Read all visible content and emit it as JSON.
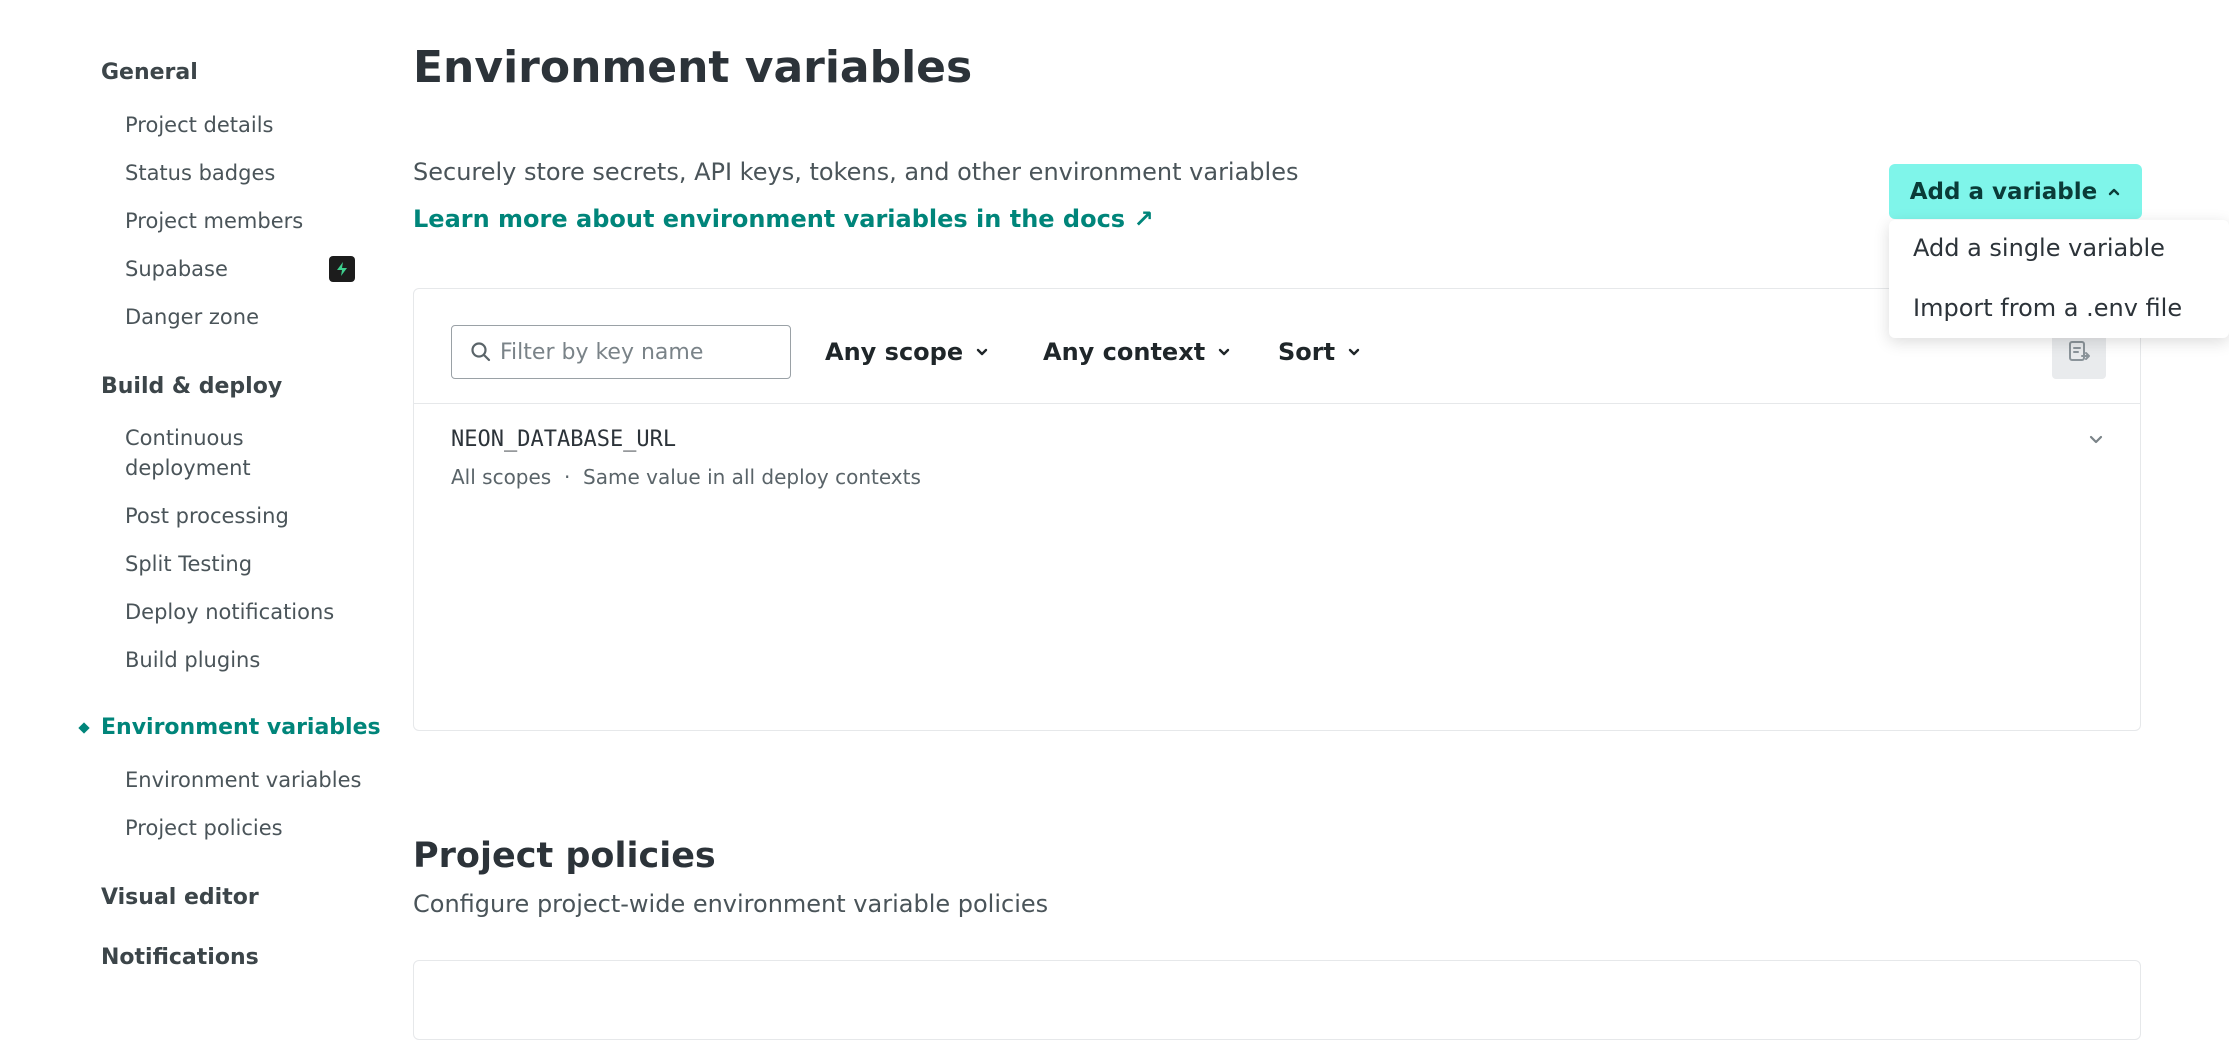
{
  "sidebar": {
    "groups": {
      "general": "General",
      "build_deploy": "Build & deploy",
      "env_vars": "Environment variables",
      "visual_editor": "Visual editor",
      "notifications": "Notifications"
    },
    "general_items": [
      "Project details",
      "Status badges",
      "Project members",
      "Supabase",
      "Danger zone"
    ],
    "build_items": [
      "Continuous deployment",
      "Post processing",
      "Split Testing",
      "Deploy notifications",
      "Build plugins"
    ],
    "env_items": [
      "Environment variables",
      "Project policies"
    ],
    "active_group": "Environment variables"
  },
  "main": {
    "title": "Environment variables",
    "description": "Securely store secrets, API keys, tokens, and other environment variables",
    "docs_link": "Learn more about environment variables in the docs ↗",
    "add_variable": {
      "label": "Add a variable",
      "menu": [
        "Add a single variable",
        "Import from a .env file"
      ]
    },
    "filter": {
      "placeholder": "Filter by key name",
      "value": ""
    },
    "toolbar": {
      "scope": "Any scope",
      "context": "Any context",
      "sort": "Sort"
    },
    "variables": [
      {
        "key": "NEON_DATABASE_URL",
        "meta": "All scopes  ·  Same value in all deploy contexts"
      }
    ]
  },
  "policies": {
    "title": "Project policies",
    "description": "Configure project-wide environment variable policies"
  },
  "colors": {
    "accent": "#00857a",
    "button_bg": "#7ff5ea",
    "text": "#2c3339",
    "border": "#e6e8ea"
  }
}
